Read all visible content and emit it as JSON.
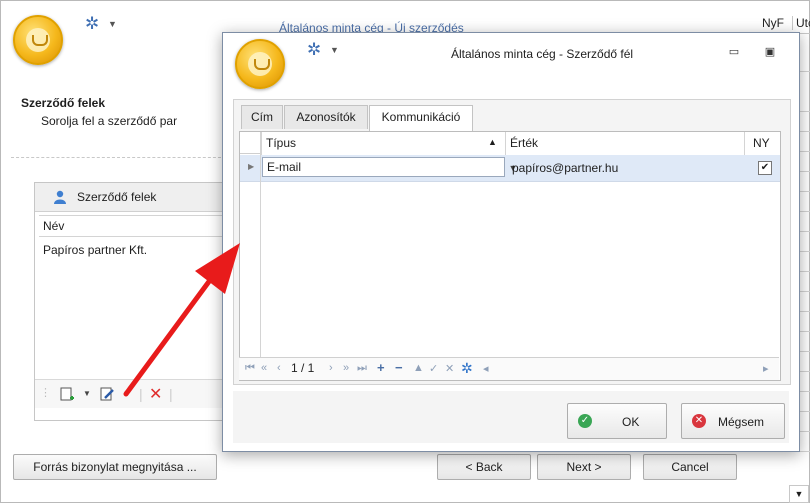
{
  "background_window": {
    "title": "Általános minta cég - Új szerződés",
    "header_columns": [
      "NyF",
      "Utc"
    ],
    "section_title": "Szerződő felek",
    "section_subtitle": "Sorolja fel a szerződő par",
    "panel": {
      "title": "Szerződő felek",
      "column_header": "Név",
      "rows": [
        "Papíros partner Kft."
      ]
    },
    "footer": {
      "source_button": "Forrás bizonylat megnyitása ...",
      "back_button": "< Back",
      "next_button": "Next >",
      "cancel_button": "Cancel"
    }
  },
  "dialog": {
    "title": "Általános minta cég - Szerződő fél",
    "tabs": [
      {
        "label": "Cím",
        "active": false
      },
      {
        "label": "Azonosítók",
        "active": false
      },
      {
        "label": "Kommunikáció",
        "active": true
      }
    ],
    "grid": {
      "columns": [
        "Típus",
        "Érték",
        "NY"
      ],
      "rows": [
        {
          "type": "E-mail",
          "value": "papíros@partner.hu",
          "ny": true
        }
      ]
    },
    "navigator": {
      "page": "1 / 1"
    },
    "ok_button": "OK",
    "cancel_button": "Mégsem"
  },
  "colors": {
    "accent": "#3f6fb3",
    "ok_green": "#3aa655",
    "cancel_red": "#d9363e",
    "arrow": "#e81b1b"
  }
}
